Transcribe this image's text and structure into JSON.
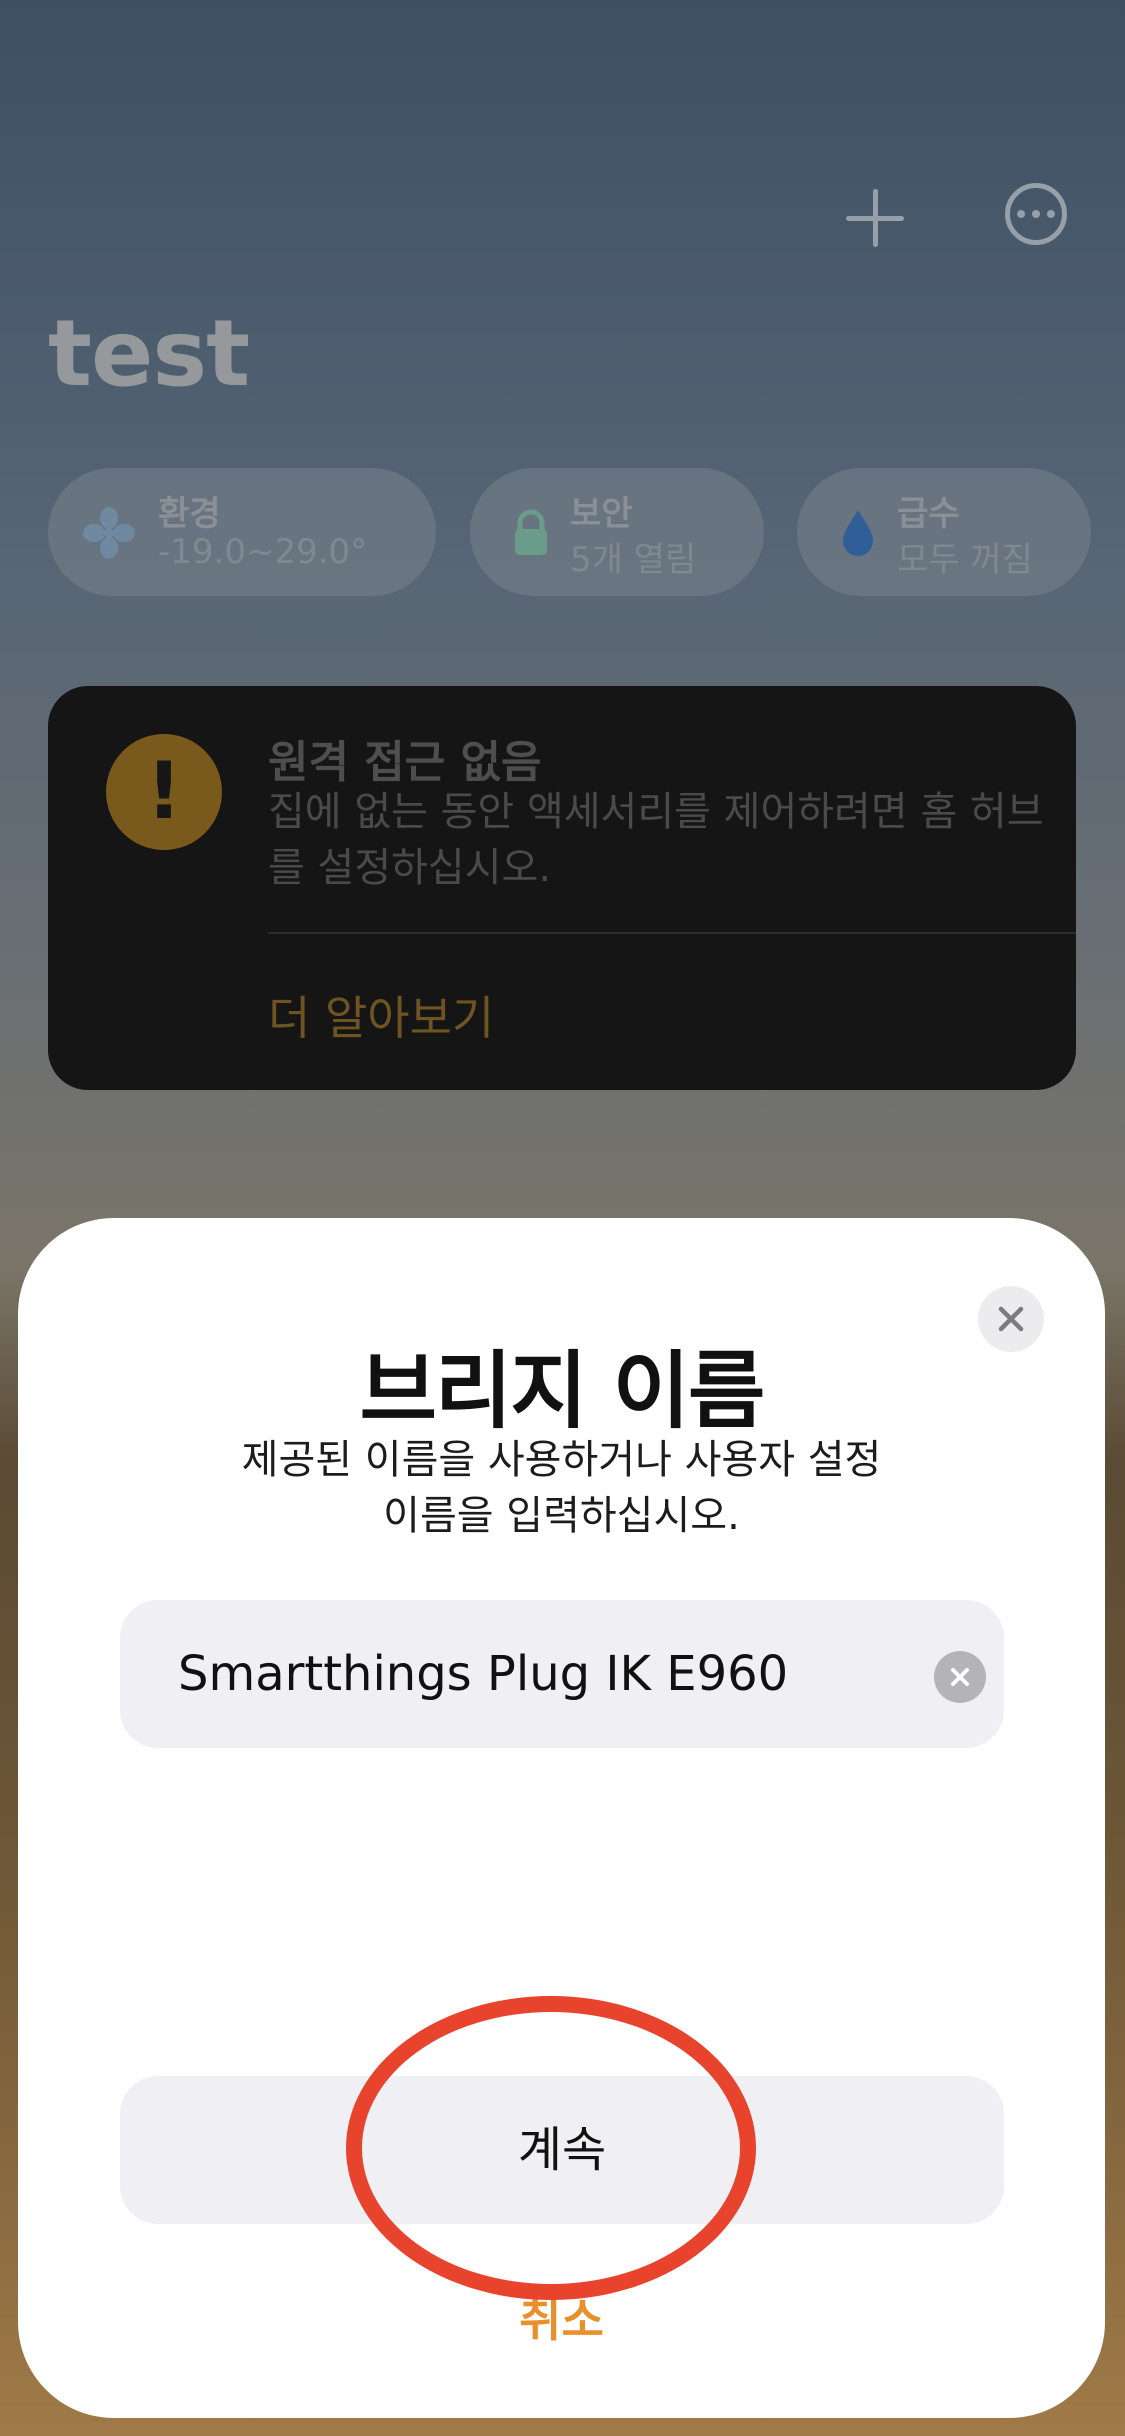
{
  "header": {
    "home_title": "test",
    "add_icon": "plus-icon",
    "more_icon": "ellipsis-circle-icon"
  },
  "status_chips": [
    {
      "icon": "fan-icon",
      "title": "환경",
      "value": "-19.0~29.0°"
    },
    {
      "icon": "lock-icon",
      "title": "보안",
      "value": "5개 열림"
    },
    {
      "icon": "water-drop-icon",
      "title": "급수",
      "value": "모두 꺼짐"
    }
  ],
  "alert_card": {
    "icon": "exclamation-circle-icon",
    "title": "원격 접근 없음",
    "body": "집에 없는 동안 액세서리를 제어하려면 홈 허브를 설정하십시오.",
    "link": "더 알아보기"
  },
  "sheet": {
    "title": "브리지 이름",
    "subtitle_line1": "제공된 이름을 사용하거나 사용자 설정",
    "subtitle_line2": "이름을 입력하십시오.",
    "name_value": "Smartthings Plug IK E960",
    "continue_label": "계속",
    "cancel_label": "취소"
  },
  "colors": {
    "accent_orange": "#e8912c",
    "annotation_red": "#e8432c",
    "field_bg": "#efeff4"
  }
}
